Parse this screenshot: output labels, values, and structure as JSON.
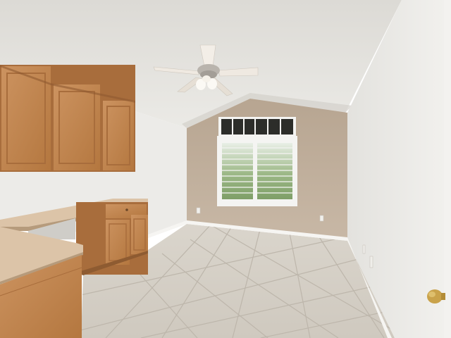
{
  "photo": {
    "subject": "empty-room-with-built-in-desk-and-ceiling-fan",
    "colors": {
      "ceiling": "#e4e3df",
      "ceiling_shadow": "#d6d4cf",
      "back_wall": "#c4b3a0",
      "right_wall": "#e6e5e1",
      "left_wall": "#ecebe8",
      "cabinet_wood": "#c48a55",
      "cabinet_wood_dark": "#a86d3c",
      "countertop": "#dcc4a8",
      "floor_tile": "#d6d1c8",
      "floor_grout": "#bdb6ab",
      "baseboard": "#f6f5f2",
      "window_frame": "#f4f4f2",
      "outside_green": "#8fae77",
      "fan_blade": "#efe9e1",
      "fan_metal": "#b9b4ad",
      "door_knob": "#c9a24a"
    },
    "icons": [
      "ceiling-fan-icon",
      "window-icon",
      "cabinet-icon",
      "door-knob-icon",
      "outlet-icon"
    ]
  }
}
